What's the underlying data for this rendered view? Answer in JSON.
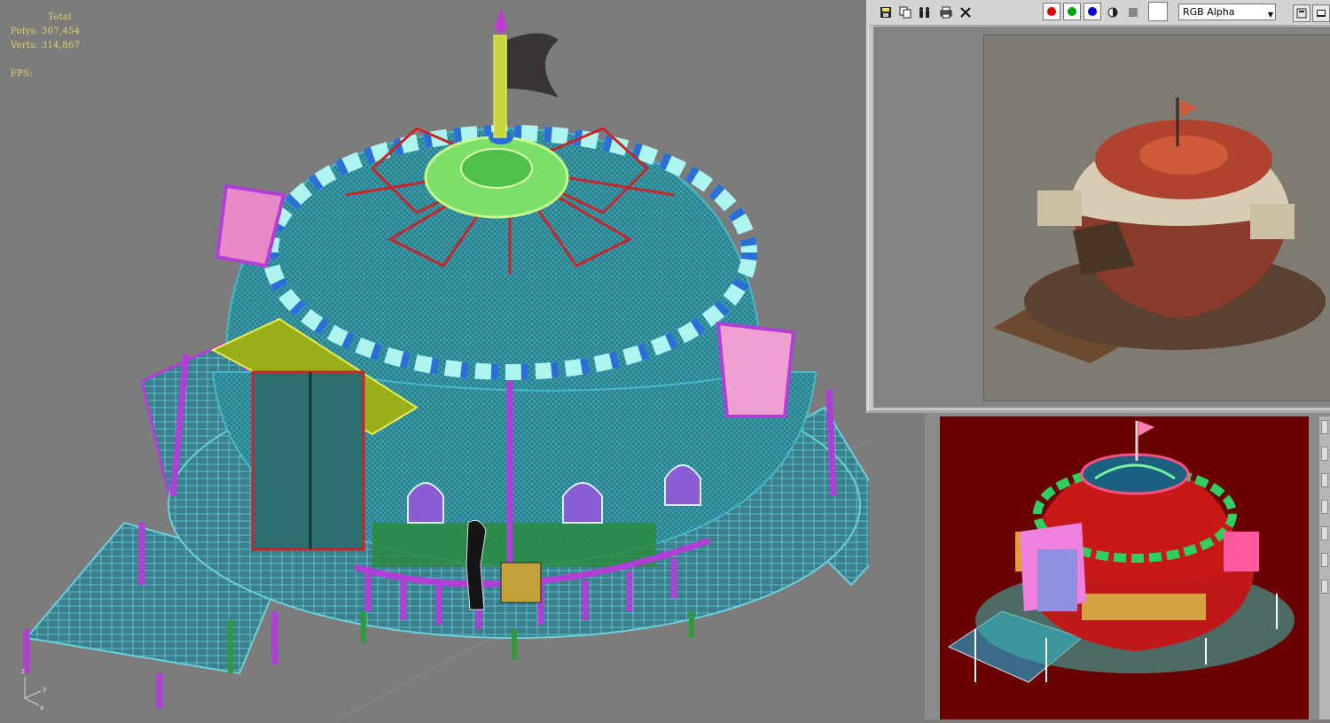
{
  "viewport": {
    "stats": {
      "total_label": "Total",
      "polys_label": "Polys:",
      "polys_value": "307,454",
      "verts_label": "Verts:",
      "verts_value": "314,867",
      "fps_label": "FPS:"
    },
    "axis": {
      "x": "x",
      "y": "y",
      "z": "z"
    }
  },
  "render_window": {
    "toolbar": {
      "save_icon": "save-icon",
      "copy_icon": "copy-icon",
      "clone_icon": "clone-icon",
      "print_icon": "print-icon",
      "clear_icon": "clear-icon",
      "red_channel_color": "#e00000",
      "green_channel_color": "#00a000",
      "blue_channel_color": "#0000e0",
      "channel_value": "RGB Alpha"
    }
  },
  "colors": {
    "viewport_bg": "#7c7c7c",
    "wire_cyan": "#2aa6b8",
    "wire_magenta": "#b23ed8",
    "wire_yellow": "#c8d43a",
    "vp2_bg": "#6a0000"
  }
}
